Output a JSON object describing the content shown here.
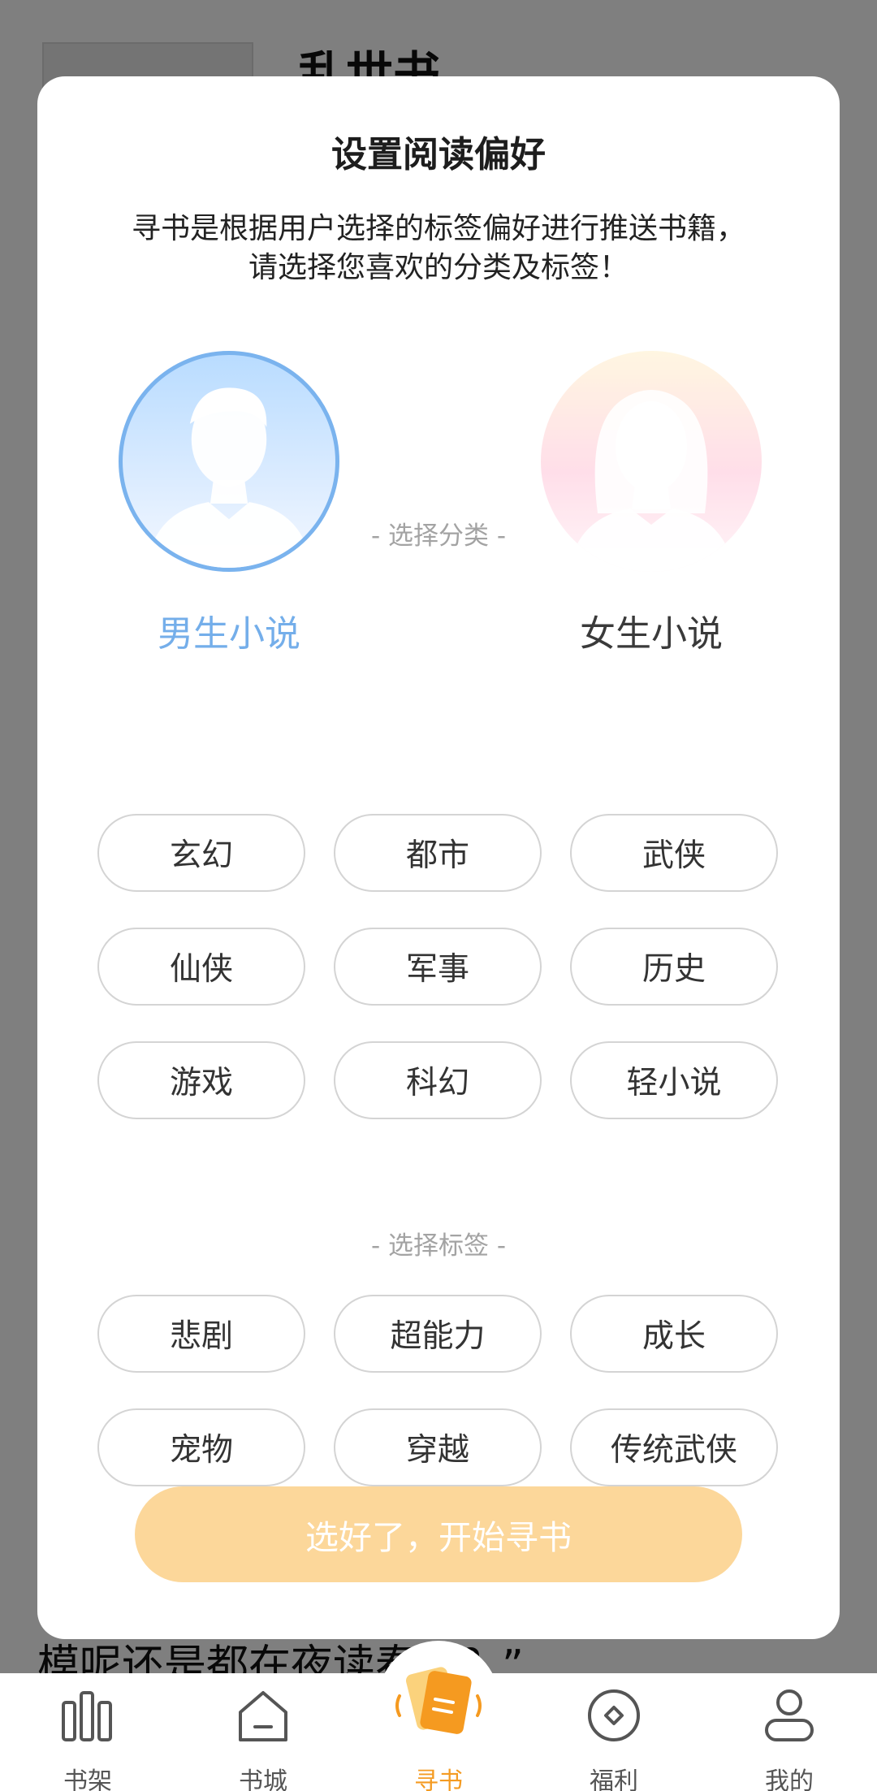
{
  "background": {
    "book_title": "乱世书",
    "text_line": "模呢还是都在夜读春秋？”"
  },
  "modal": {
    "title": "设置阅读偏好",
    "description_line1": "寻书是根据用户选择的标签偏好进行推送书籍，",
    "description_line2": "请选择您喜欢的分类及标签！",
    "male_label": "男生小说",
    "female_label": "女生小说",
    "selected_gender": "male",
    "category_header": "- 选择分类 -",
    "categories": [
      "玄幻",
      "都市",
      "武侠",
      "仙侠",
      "军事",
      "历史",
      "游戏",
      "科幻",
      "轻小说"
    ],
    "tag_header": "- 选择标签 -",
    "tags": [
      "悲剧",
      "超能力",
      "成长",
      "宠物",
      "穿越",
      "传统武侠"
    ],
    "start_button": "选好了，开始寻书",
    "colors": {
      "male_accent": "#7ab3ee",
      "button": "#fcd79a",
      "active_nav": "#f49b22"
    }
  },
  "bottom_nav": {
    "items": [
      {
        "label": "书架",
        "icon": "bookshelf-icon"
      },
      {
        "label": "书城",
        "icon": "bookstore-icon"
      },
      {
        "label": "寻书",
        "icon": "find-book-icon",
        "active": true
      },
      {
        "label": "福利",
        "icon": "welfare-icon"
      },
      {
        "label": "我的",
        "icon": "profile-icon"
      }
    ]
  }
}
